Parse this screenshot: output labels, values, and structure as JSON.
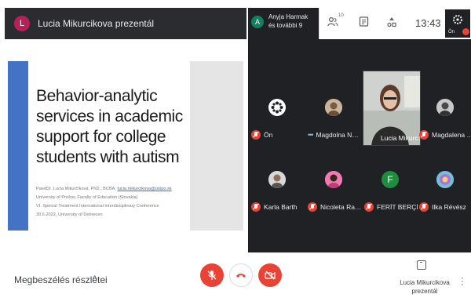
{
  "presenter": {
    "avatar_letter": "L",
    "title": "Lucia Mikurcikova prezentál"
  },
  "slide": {
    "title": "Behavior-analytic services in academic support for college students with autism",
    "lines": [
      {
        "text": "PaedDr. Lucia Mikurčíková, PhD., BCBA, ",
        "email": "lucia.mikurcikova@unipo.sk"
      },
      {
        "text": "University of Prešov, Faculty of Education (Slovakia)",
        "email": ""
      },
      {
        "text": "VI. Special Treatment International Interdisciplinary Conference",
        "email": ""
      },
      {
        "text": "30.6.2022, University of Debrecen",
        "email": ""
      }
    ]
  },
  "status": {
    "participant_initial": "A",
    "participant_line1": "Anyja Harmak",
    "participant_line2": "és további 9",
    "participant_count": "10",
    "clock": "13:43",
    "self_label": "Ön"
  },
  "tiles": [
    {
      "name": "Ön",
      "avatar": "gear",
      "indicator": "mic-off"
    },
    {
      "name": "Magdolna N…",
      "avatar": "photo",
      "indicator": "dots"
    },
    {
      "name": "Magdalena …",
      "avatar": "photo",
      "indicator": "mic-off"
    },
    {
      "name": "Karla Barth",
      "avatar": "photo",
      "indicator": "mic-off"
    },
    {
      "name": "Nicoleta Ra…",
      "avatar": "photo",
      "indicator": "mic-off"
    },
    {
      "name": "FERİT BERÇİN",
      "avatar": "F",
      "indicator": "mic-off"
    },
    {
      "name": "Ilka Révész",
      "avatar": "photo",
      "indicator": "mic-off"
    }
  ],
  "speaker": {
    "name": "Lucia Mikurc…"
  },
  "bottom": {
    "details_label": "Megbeszélés részletei",
    "details_chevron": "^",
    "presenting_line1": "Lucia Mikurcikova",
    "presenting_line2": "prezentál"
  },
  "colors": {
    "accent": "#4472c4",
    "danger": "#ea4335",
    "bg_dark": "#202124"
  }
}
